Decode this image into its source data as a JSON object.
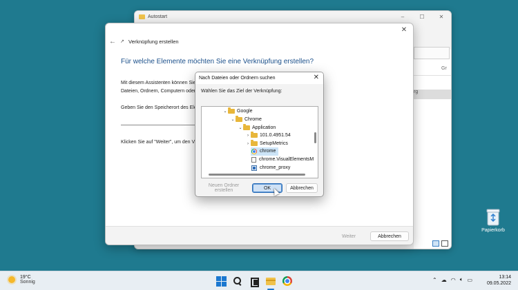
{
  "background_window": {
    "title": "Autostart",
    "column_header_fragment": "Gr",
    "row_fragment": "rg"
  },
  "wizard": {
    "title": "Verknüpfung erstellen",
    "heading": "Für welche Elemente möchten Sie eine Verknüpfung erstellen?",
    "intro_line1": "Mit diesem Assistenten können Sie",
    "intro_line2": "Dateien, Ordnern, Computern oder",
    "location_label": "Geben Sie den Speicherort des Ele",
    "next_hint": "Klicken Sie auf \"Weiter\", um den Vo",
    "next_button": "Weiter",
    "cancel_button": "Abbrechen"
  },
  "browse_dialog": {
    "title": "Nach Dateien oder Ordnern suchen",
    "prompt": "Wählen Sie das Ziel der Verknüpfung:",
    "tree": [
      {
        "label": "Google",
        "icon": "folder-icon",
        "chevron": "v",
        "level": 0
      },
      {
        "label": "Chrome",
        "icon": "folder-icon",
        "chevron": "v",
        "level": 1
      },
      {
        "label": "Application",
        "icon": "folder-icon",
        "chevron": "v",
        "level": 2
      },
      {
        "label": "101.0.4951.54",
        "icon": "folder-icon",
        "chevron": ">",
        "level": 3
      },
      {
        "label": "SetupMetrics",
        "icon": "folder-icon",
        "chevron": ">",
        "level": 3
      },
      {
        "label": "chrome",
        "icon": "chrome-icon",
        "chevron": "",
        "level": 3,
        "selected": true
      },
      {
        "label": "chrome.VisualElementsM",
        "icon": "file-icon",
        "chevron": "",
        "level": 3
      },
      {
        "label": "chrome_proxy",
        "icon": "exe-icon",
        "chevron": "",
        "level": 3
      }
    ],
    "new_folder_button": "Neuen Ordner erstellen",
    "ok_button": "OK",
    "cancel_button": "Abbrechen"
  },
  "desktop": {
    "recycle_bin_label": "Papierkorb"
  },
  "taskbar": {
    "weather_temp": "19°C",
    "weather_desc": "Sonnig",
    "time": "13:14",
    "date": "09.05.2022"
  },
  "colors": {
    "desktop": "#1f7a8f",
    "accent": "#1b78d0",
    "heading": "#1a4f8a",
    "selection": "#cce4f7"
  }
}
